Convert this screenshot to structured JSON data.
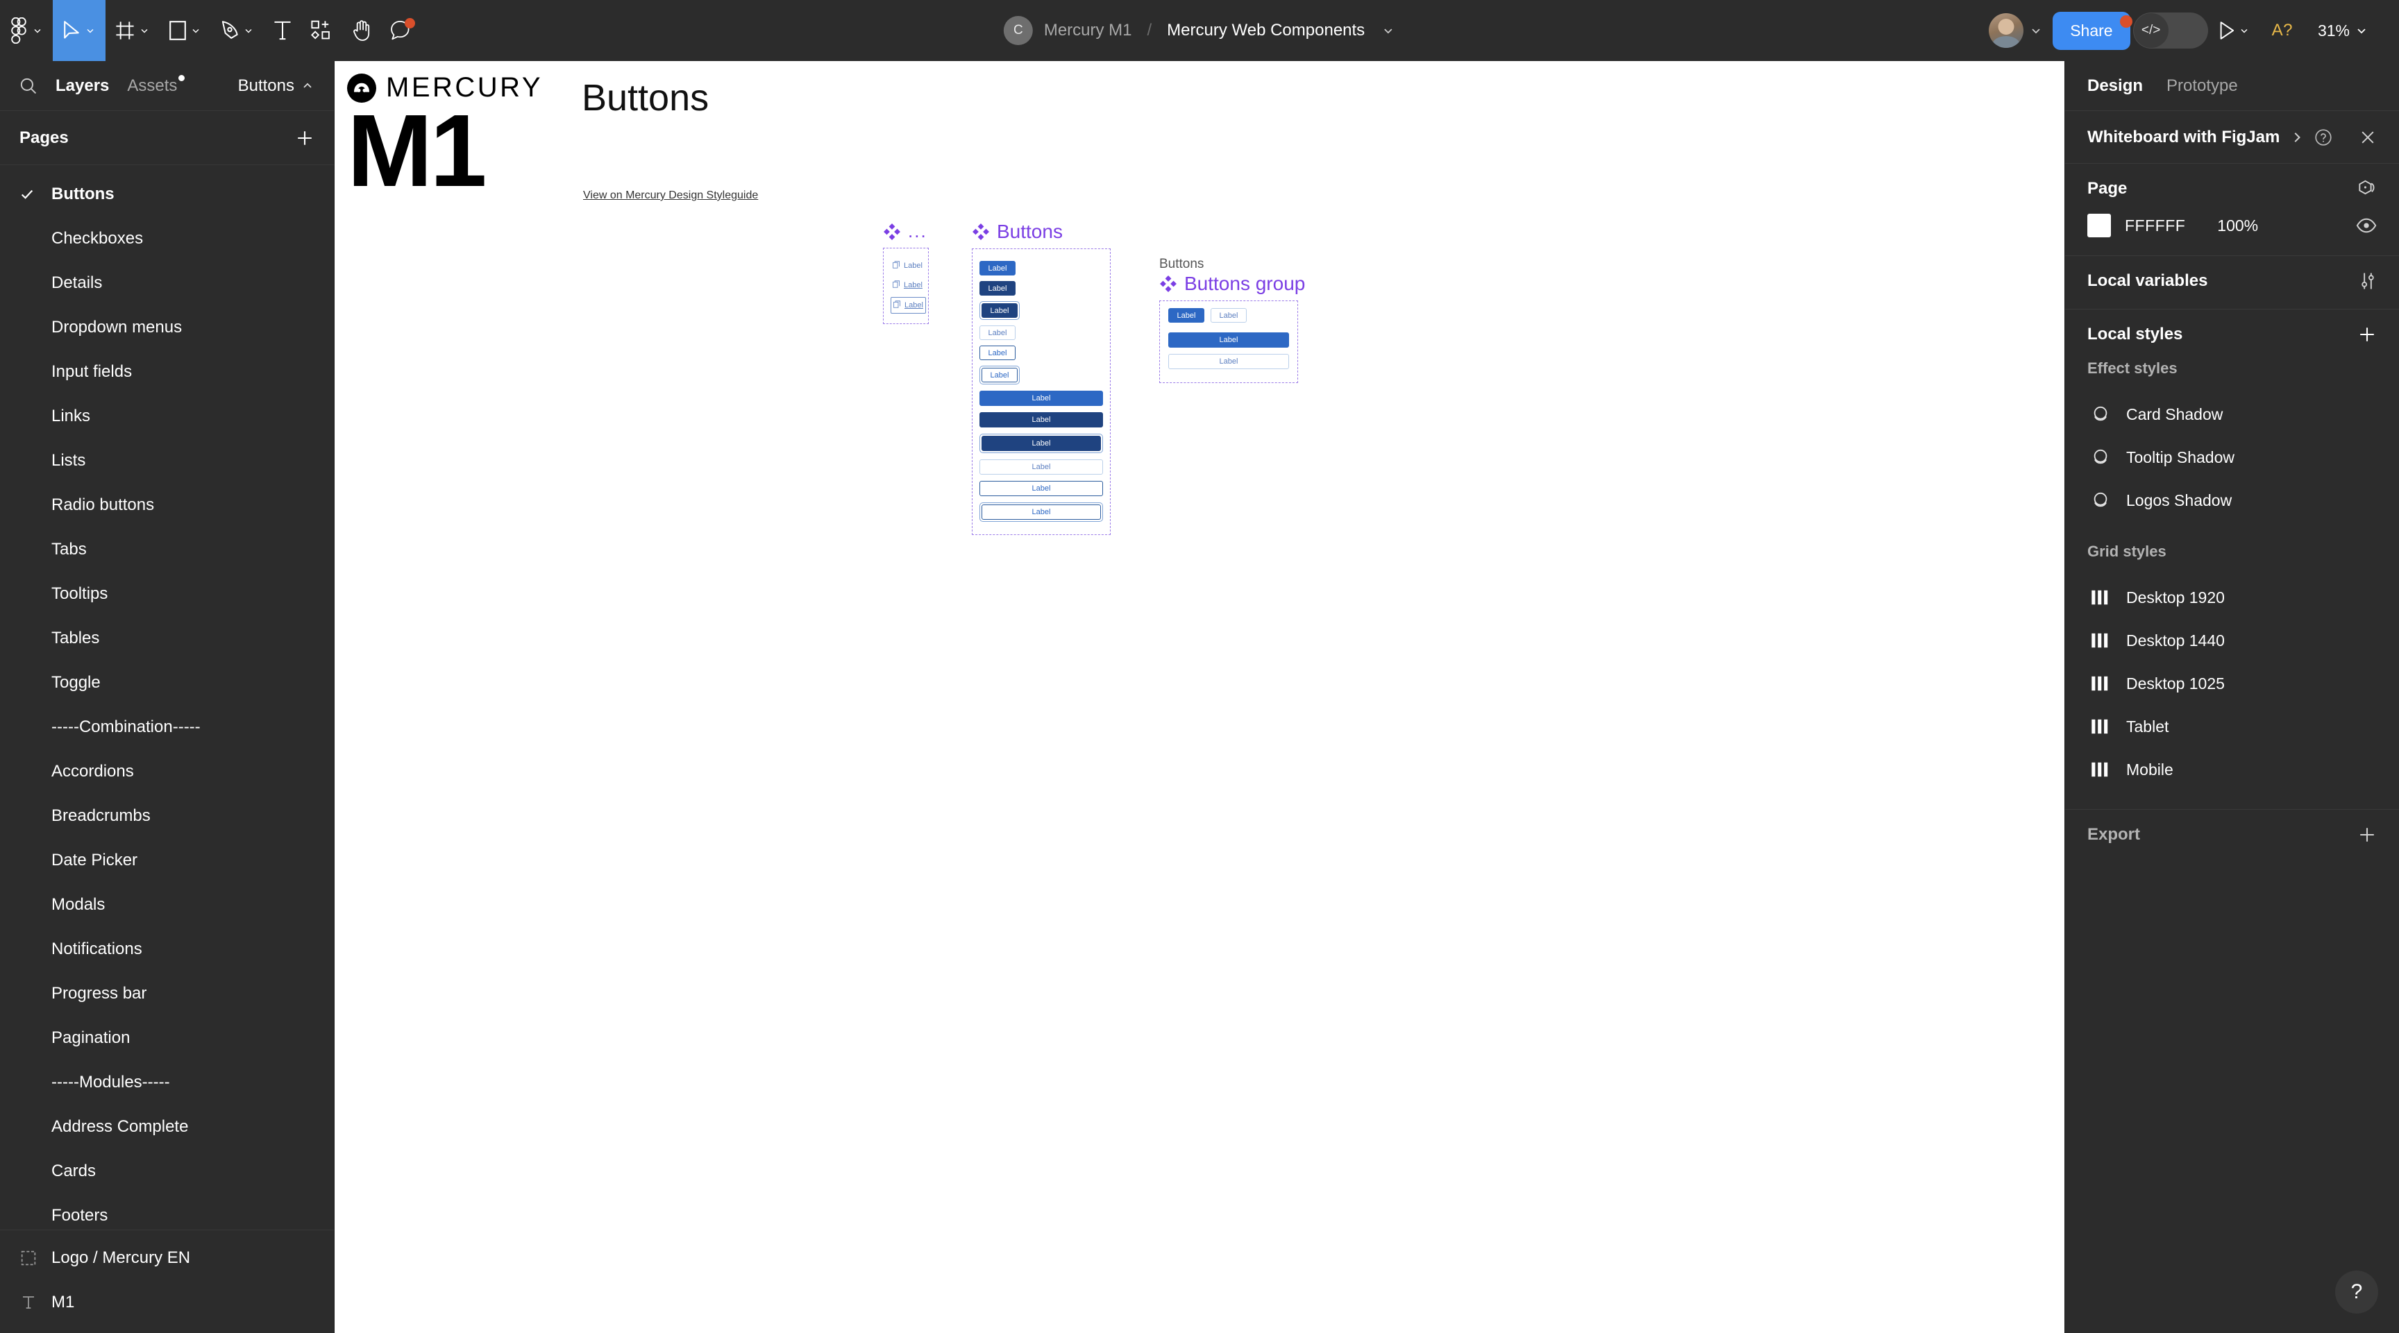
{
  "toolbar": {
    "tools": [
      {
        "name": "figma-menu-icon",
        "label": "Figma menu",
        "caret": true,
        "active": false
      },
      {
        "name": "move-tool-icon",
        "label": "Move",
        "caret": true,
        "active": true
      },
      {
        "name": "frame-tool-icon",
        "label": "Frame",
        "caret": true,
        "active": false
      },
      {
        "name": "shape-tool-icon",
        "label": "Rectangle",
        "caret": true,
        "active": false
      },
      {
        "name": "pen-tool-icon",
        "label": "Pen",
        "caret": true,
        "active": false
      },
      {
        "name": "text-tool-icon",
        "label": "Text",
        "caret": false,
        "active": false
      },
      {
        "name": "actions-tool-icon",
        "label": "Actions",
        "caret": false,
        "active": false
      },
      {
        "name": "hand-tool-icon",
        "label": "Hand",
        "caret": false,
        "active": false
      },
      {
        "name": "comment-tool-icon",
        "label": "Comment",
        "caret": false,
        "active": false
      }
    ],
    "breadcrumb": {
      "avatar_initial": "C",
      "team": "Mercury M1",
      "separator": "/",
      "file": "Mercury Web Components"
    },
    "share_label": "Share",
    "dev_mode_label": "</>",
    "annotation_label": "A?",
    "zoom_level": "31%"
  },
  "sidebar": {
    "tabs": [
      {
        "label": "Layers",
        "active": true
      },
      {
        "label": "Assets",
        "active": false,
        "dot": true
      }
    ],
    "current_page_chip": "Buttons",
    "pages_title": "Pages",
    "pages": [
      {
        "label": "Buttons",
        "selected": true
      },
      {
        "label": "Checkboxes",
        "selected": false
      },
      {
        "label": "Details",
        "selected": false
      },
      {
        "label": "Dropdown menus",
        "selected": false
      },
      {
        "label": "Input fields",
        "selected": false
      },
      {
        "label": "Links",
        "selected": false
      },
      {
        "label": "Lists",
        "selected": false
      },
      {
        "label": "Radio buttons",
        "selected": false
      },
      {
        "label": "Tabs",
        "selected": false
      },
      {
        "label": "Tooltips",
        "selected": false
      },
      {
        "label": "Tables",
        "selected": false
      },
      {
        "label": "Toggle",
        "selected": false
      },
      {
        "label": "-----Combination-----",
        "selected": false
      },
      {
        "label": "Accordions",
        "selected": false
      },
      {
        "label": "Breadcrumbs",
        "selected": false
      },
      {
        "label": "Date Picker",
        "selected": false
      },
      {
        "label": "Modals",
        "selected": false
      },
      {
        "label": "Notifications",
        "selected": false
      },
      {
        "label": "Progress bar",
        "selected": false
      },
      {
        "label": "Pagination",
        "selected": false
      },
      {
        "label": "-----Modules-----",
        "selected": false
      },
      {
        "label": "Address Complete",
        "selected": false
      },
      {
        "label": "Cards",
        "selected": false
      },
      {
        "label": "Footers",
        "selected": false
      }
    ],
    "layers": [
      {
        "label": "Logo / Mercury EN",
        "icon": "frame-icon"
      },
      {
        "label": "M1",
        "icon": "text-layer-icon"
      }
    ]
  },
  "canvas": {
    "logo": {
      "wordmark": "MERCURY",
      "big_text": "M1"
    },
    "frame_title": "Buttons",
    "styleguide_link": "View on Mercury Design Styleguide",
    "component_sets": [
      {
        "name": "...",
        "kind": "links",
        "items": [
          {
            "label": "Label",
            "style": "plain"
          },
          {
            "label": "Label",
            "style": "underline"
          },
          {
            "label": "Label",
            "style": "focused"
          }
        ]
      },
      {
        "name": "Buttons",
        "kind": "buttons",
        "items": [
          {
            "label": "Label",
            "variant": "primary",
            "width": "small"
          },
          {
            "label": "Label",
            "variant": "dark",
            "width": "small"
          },
          {
            "label": "Label",
            "variant": "dark-focus",
            "width": "small"
          },
          {
            "label": "Label",
            "variant": "outline-light",
            "width": "small"
          },
          {
            "label": "Label",
            "variant": "outline-dark",
            "width": "small"
          },
          {
            "label": "Label",
            "variant": "outline-focus",
            "width": "small"
          },
          {
            "label": "Label",
            "variant": "primary",
            "width": "full"
          },
          {
            "label": "Label",
            "variant": "dark",
            "width": "full"
          },
          {
            "label": "Label",
            "variant": "dark-focus",
            "width": "full"
          },
          {
            "label": "Label",
            "variant": "outline-light",
            "width": "full"
          },
          {
            "label": "Label",
            "variant": "outline-dark",
            "width": "full"
          },
          {
            "label": "Label",
            "variant": "outline-focus",
            "width": "full"
          }
        ]
      },
      {
        "name": "Buttons group",
        "kind": "group",
        "group_caption": "Buttons",
        "items": [
          {
            "label": "Label",
            "variant": "primary",
            "width": "small"
          },
          {
            "label": "Label",
            "variant": "outline-light",
            "width": "small"
          },
          {
            "label": "Label",
            "variant": "primary",
            "width": "full"
          },
          {
            "label": "Label",
            "variant": "outline-light",
            "width": "full"
          }
        ]
      }
    ]
  },
  "right_panel": {
    "tabs": [
      {
        "label": "Design",
        "active": true
      },
      {
        "label": "Prototype",
        "active": false
      }
    ],
    "banner_title": "Whiteboard with FigJam",
    "page_section": {
      "title": "Page",
      "fill_hex": "FFFFFF",
      "fill_opacity": "100%"
    },
    "local_variables_title": "Local variables",
    "local_styles_title": "Local styles",
    "effect_styles_title": "Effect styles",
    "effect_styles": [
      {
        "label": "Card Shadow"
      },
      {
        "label": "Tooltip Shadow"
      },
      {
        "label": "Logos Shadow"
      }
    ],
    "grid_styles_title": "Grid styles",
    "grid_styles": [
      {
        "label": "Desktop 1920"
      },
      {
        "label": "Desktop 1440"
      },
      {
        "label": "Desktop 1025"
      },
      {
        "label": "Tablet"
      },
      {
        "label": "Mobile"
      }
    ],
    "export_title": "Export"
  },
  "help_label": "?",
  "colors": {
    "chrome": "#2C2C2C",
    "accent_blue": "#3D8BF2",
    "tool_active": "#4A90E2",
    "component_purple": "#7B3FE4",
    "button_primary": "#2D68C4",
    "button_dark": "#1F4380",
    "notification_red": "#D94F2B",
    "annotation_yellow": "#E9B949"
  }
}
